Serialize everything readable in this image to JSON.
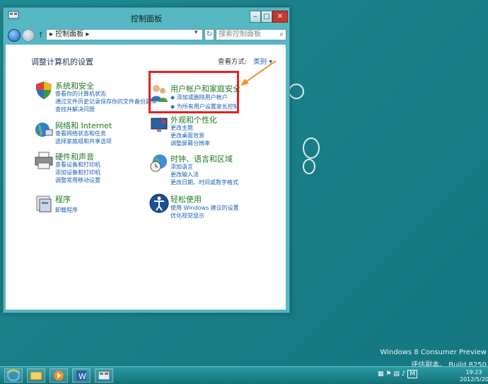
{
  "window": {
    "title": "控制面板",
    "minimize": "–",
    "maximize": "□",
    "close": "✕"
  },
  "address": {
    "path": "▸ 控制面板 ▸",
    "dropdown": "▾",
    "refresh": "↻",
    "search_placeholder": "搜索控制面板",
    "up": "↑"
  },
  "content": {
    "heading": "调整计算机的设置",
    "view_by_label": "查看方式:",
    "view_by_value": "类别 ▾"
  },
  "categories": [
    {
      "title": "系统和安全",
      "links": [
        "查看你的计算机状态",
        "通过文件历史记录保存你的文件备份副本",
        "查找并解决问题"
      ]
    },
    {
      "title": "网络和 Internet",
      "links": [
        "查看网络状态和任务",
        "选择家庭组和共享选项"
      ]
    },
    {
      "title": "硬件和声音",
      "links": [
        "查看设备和打印机",
        "添加设备和打印机",
        "调整常用移动设置"
      ]
    },
    {
      "title": "程序",
      "links": [
        "卸载程序"
      ]
    },
    {
      "title": "用户帐户和家庭安全",
      "links": [
        "添加或删除用户帐户",
        "为所有用户设置家长控制"
      ]
    },
    {
      "title": "外观和个性化",
      "links": [
        "更改主题",
        "更改桌面背景",
        "调整屏幕分辨率"
      ]
    },
    {
      "title": "时钟、语言和区域",
      "links": [
        "添加语言",
        "更改输入法",
        "更改日期、时间或数字格式"
      ]
    },
    {
      "title": "轻松使用",
      "links": [
        "使用 Windows 建议的设置",
        "优化视觉显示"
      ]
    }
  ],
  "watermark": {
    "line1": "Windows 8 Consumer Preview",
    "line2": "评估副本。 Build 8250"
  },
  "taskbar": {
    "tray_lang": "M",
    "time": "19:23",
    "date": "2012/5/20"
  }
}
